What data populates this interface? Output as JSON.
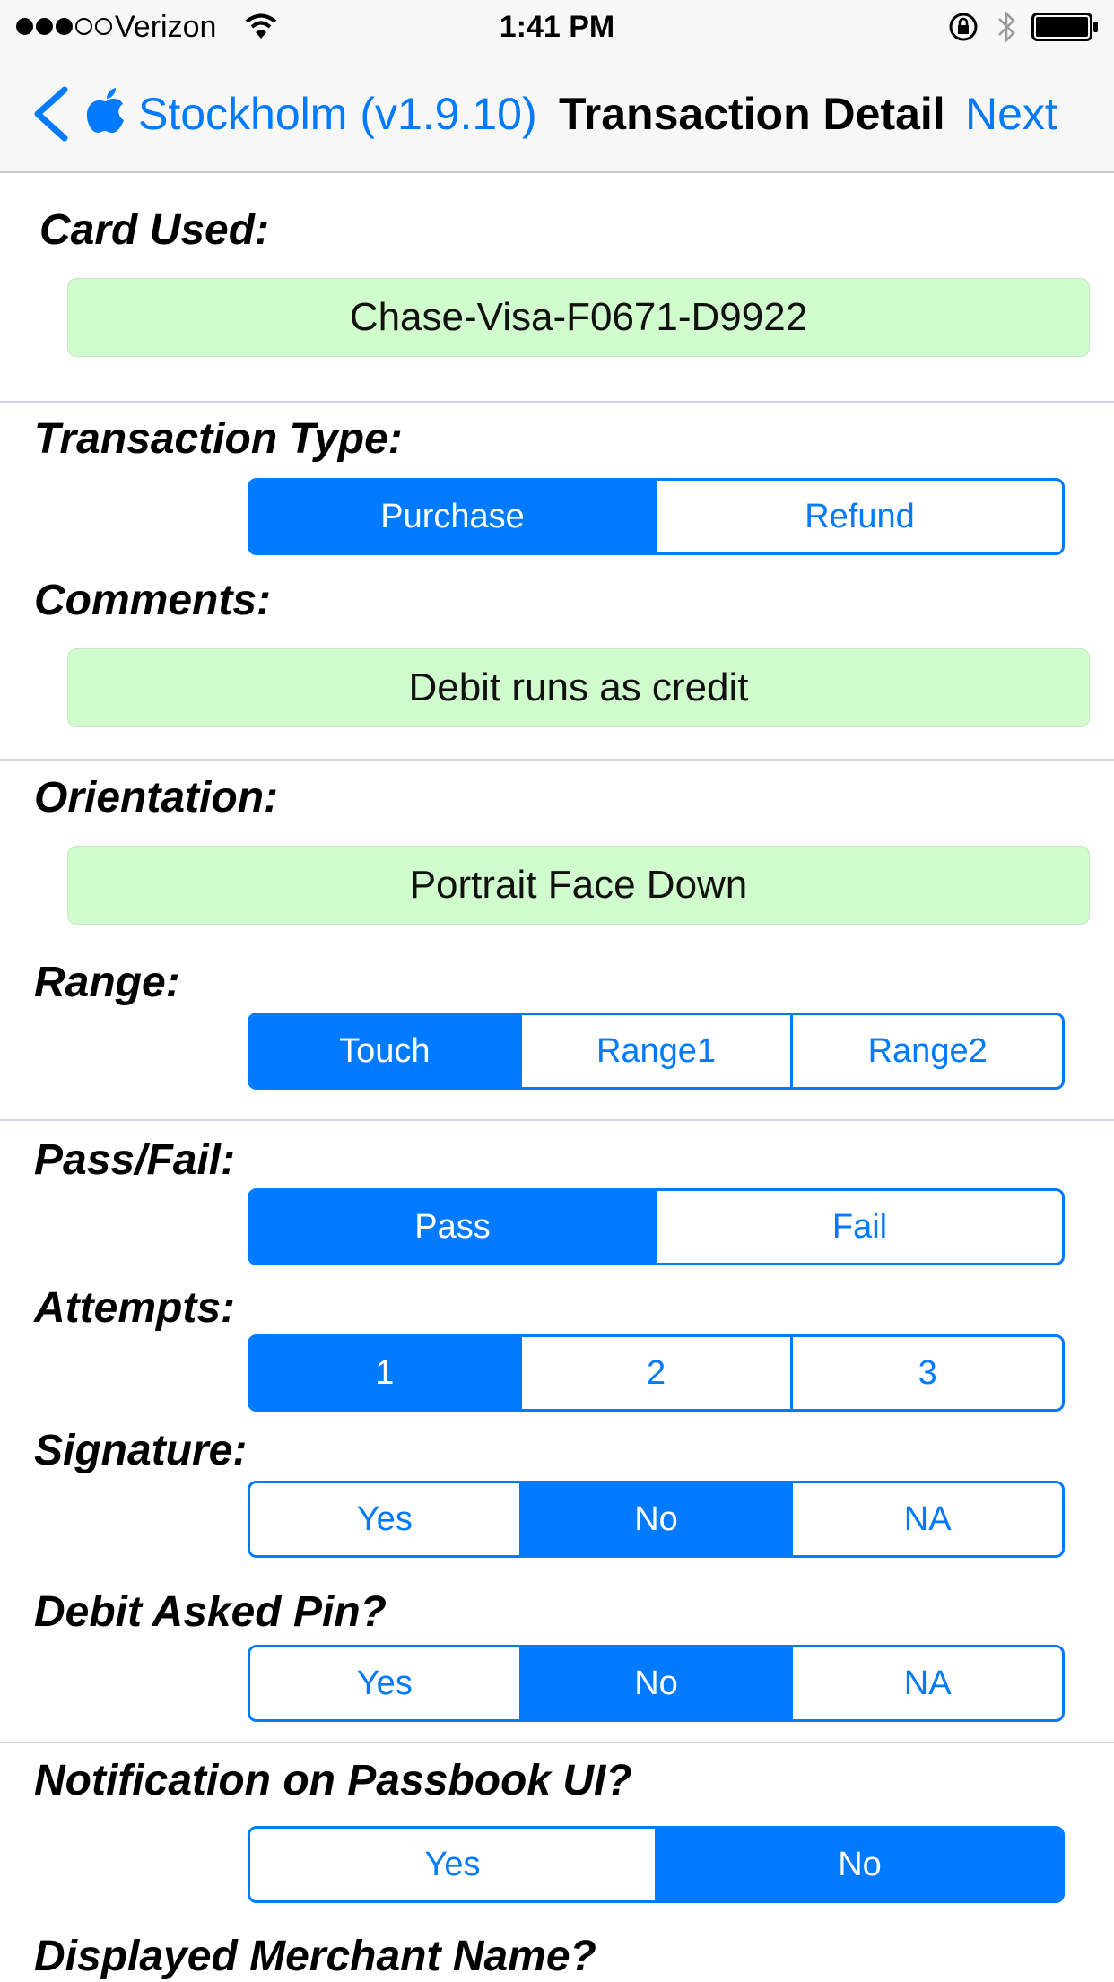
{
  "status_bar": {
    "carrier": "Verizon",
    "time": "1:41 PM",
    "signal_bars_filled": 3,
    "signal_bars_total": 5
  },
  "nav_bar": {
    "back_label": "Stockholm (v1.9.10)",
    "title": "Transaction Detail",
    "next_label": "Next"
  },
  "form": {
    "card_used": {
      "label": "Card Used:",
      "value": "Chase-Visa-F0671-D9922"
    },
    "transaction_type": {
      "label": "Transaction Type:",
      "options": [
        "Purchase",
        "Refund"
      ],
      "selected": 0
    },
    "comments": {
      "label": "Comments:",
      "value": "Debit runs as credit"
    },
    "orientation": {
      "label": "Orientation:",
      "value": "Portrait Face Down"
    },
    "range": {
      "label": "Range:",
      "options": [
        "Touch",
        "Range1",
        "Range2"
      ],
      "selected": 0
    },
    "pass_fail": {
      "label": "Pass/Fail:",
      "options": [
        "Pass",
        "Fail"
      ],
      "selected": 0
    },
    "attempts": {
      "label": "Attempts:",
      "options": [
        "1",
        "2",
        "3"
      ],
      "selected": 0
    },
    "signature": {
      "label": "Signature:",
      "options": [
        "Yes",
        "No",
        "NA"
      ],
      "selected": 1
    },
    "debit_asked_pin": {
      "label": "Debit Asked Pin?",
      "options": [
        "Yes",
        "No",
        "NA"
      ],
      "selected": 1
    },
    "notification_passbook": {
      "label": "Notification on Passbook UI?",
      "options": [
        "Yes",
        "No"
      ],
      "selected": 1
    },
    "displayed_merchant_name": {
      "label": "Displayed Merchant Name?"
    }
  },
  "colors": {
    "accent": "#007aff",
    "field_background": "#d0fbcc",
    "divider": "#d3d2ee",
    "bar_background": "#f7f7f7"
  }
}
